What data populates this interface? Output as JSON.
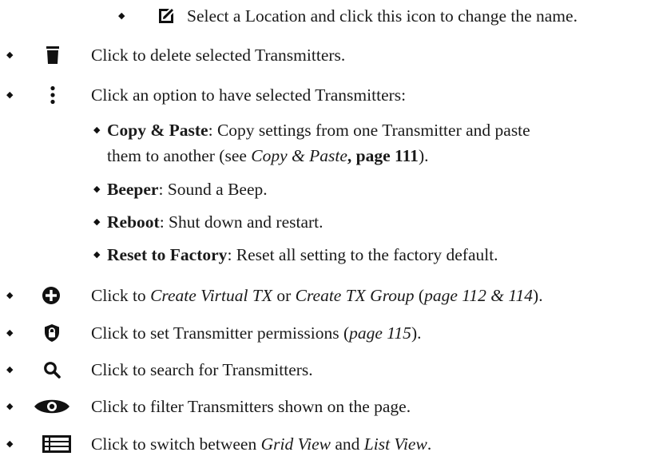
{
  "items": [
    {
      "icon": "edit-square-icon",
      "text": "Select a Location and click this icon to change the name."
    },
    {
      "icon": "trash-icon",
      "text": "Click to delete selected Transmitters."
    },
    {
      "icon": "more-vertical-icon",
      "text": "Click an option to have selected Transmitters:"
    },
    {
      "icon": "plus-circle-icon",
      "text_pre": "Click to ",
      "em1": "Create Virtual TX",
      "mid": " or ",
      "em2": "Create TX Group",
      "paren_open": " (",
      "page_ref": "page 112 & 114",
      "paren_close": ")."
    },
    {
      "icon": "shield-lock-icon",
      "text_pre": "Click to set Transmitter permissions (",
      "page_ref": "page 115",
      "text_post": ")."
    },
    {
      "icon": "search-icon",
      "text": "Click to search for Transmitters."
    },
    {
      "icon": "eye-icon",
      "text": "Click to filter Transmitters shown on the page."
    },
    {
      "icon": "list-view-icon",
      "text_pre": "Click to switch between ",
      "em1": "Grid View",
      "mid": " and ",
      "em2": "List View",
      "text_post": "."
    }
  ],
  "options": [
    {
      "label": "Copy & Paste",
      "line1": ": Copy settings from one Transmitter and paste",
      "line2_pre": "them to another (see ",
      "ref_italic": "Copy & Paste",
      "ref_bold": ", page 111",
      "line2_post": ")."
    },
    {
      "label": "Beeper",
      "text": ": Sound a Beep."
    },
    {
      "label": "Reboot",
      "text": ": Shut down and restart."
    },
    {
      "label": "Reset to Factory",
      "text": ": Reset all setting to the factory default."
    }
  ],
  "bullet_glyph": "◆"
}
